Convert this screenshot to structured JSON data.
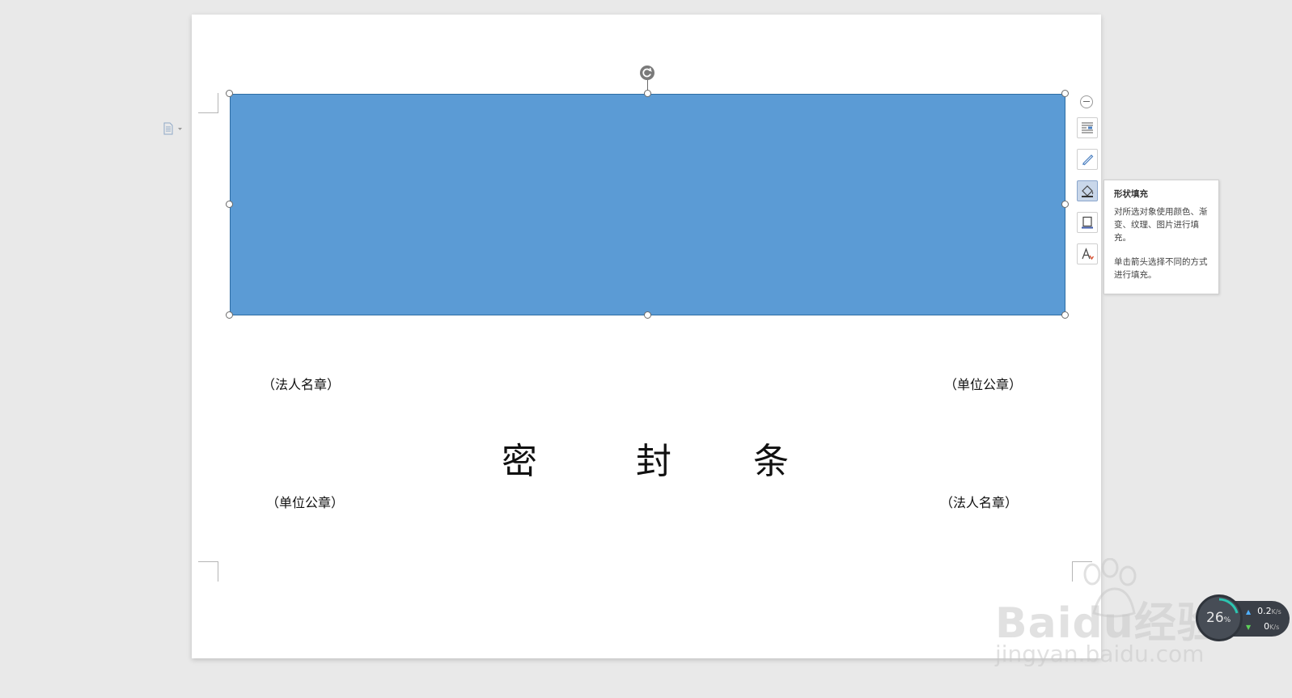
{
  "document": {
    "labels": {
      "top_left": "（法人名章）",
      "top_right": "（单位公章）",
      "bottom_left": "（单位公章）",
      "bottom_right": "（法人名章）"
    },
    "center_title": [
      "密",
      "封",
      "条"
    ]
  },
  "shape": {
    "fill_color": "#5b9bd5",
    "border_color": "#2e6da4"
  },
  "toolbar": {
    "collapse": "collapse-icon",
    "tools": [
      {
        "name": "layout-options-icon"
      },
      {
        "name": "shape-style-icon"
      },
      {
        "name": "shape-fill-icon",
        "active": true
      },
      {
        "name": "shape-outline-icon"
      },
      {
        "name": "text-fill-icon"
      }
    ]
  },
  "tooltip": {
    "title": "形状填充",
    "body1": "对所选对象使用颜色、渐变、纹理、图片进行填充。",
    "body2": "单击箭头选择不同的方式进行填充。"
  },
  "network_monitor": {
    "percent": "26",
    "percent_unit": "%",
    "upload": "0.2",
    "download": "0",
    "unit": "K/s"
  },
  "watermark": {
    "main": "Baidu经验",
    "sub": "jingyan.baidu.com"
  }
}
